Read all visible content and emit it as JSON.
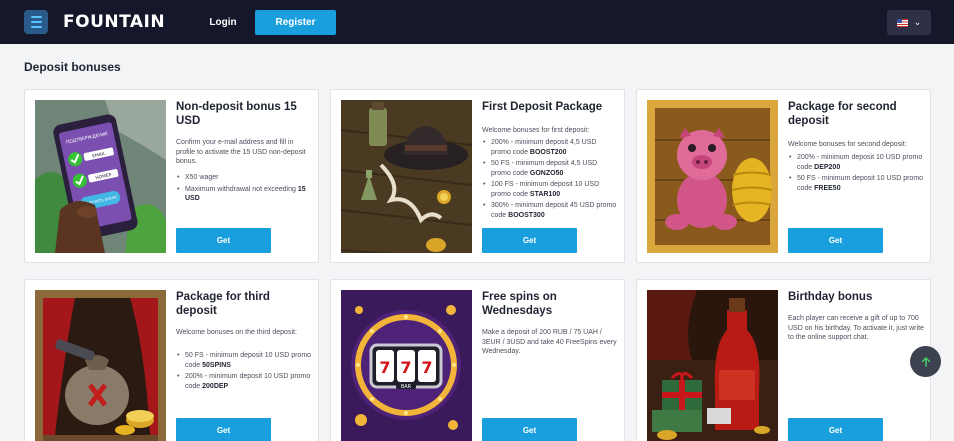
{
  "header": {
    "logo": "FOUNTAIN",
    "login_label": "Login",
    "register_label": "Register",
    "language_flag": "us-flag-icon"
  },
  "section_title": "Deposit bonuses",
  "cards": [
    {
      "title": "Non-deposit bonus 15 USD",
      "description": "Confirm your e-mail address and fill in profile to activate the 15 USD non-deposit bonus.",
      "items": [
        {
          "text": "X50 wager",
          "code": ""
        },
        {
          "text": "Maximum withdrawal not exceeding",
          "code": "15 USD"
        }
      ],
      "button": "Get",
      "image_text": [
        "ПОДТВЕРЖДЕНИЕ",
        "EMAIL",
        "НОМЕР",
        "ПОЛУЧИТЬ БОНУС"
      ]
    },
    {
      "title": "First Deposit Package",
      "description": "Welcome bonuses for first deposit:",
      "items": [
        {
          "text": "200% - minimum deposit 4,5 USD promo code",
          "code": "BOOST200"
        },
        {
          "text": "50 FS - minimum deposit 4,5 USD promo code",
          "code": "GONZO50"
        },
        {
          "text": "100 FS - minimum deposit 10 USD promo code",
          "code": "STAR100"
        },
        {
          "text": "300% - minimum deposit 45 USD promo code",
          "code": "BOOST300"
        }
      ],
      "button": "Get"
    },
    {
      "title": "Package for second deposit",
      "description": "Welcome bonuses for second deposit:",
      "items": [
        {
          "text": "200% - minimum deposit 10 USD promo code",
          "code": "DEP200"
        },
        {
          "text": "50 FS - minimum deposit 10 USD promo code",
          "code": "FREE50"
        }
      ],
      "button": "Get"
    },
    {
      "title": "Package for third deposit",
      "description": "Welcome bonuses on the third deposit:",
      "items": [
        {
          "text": "50 FS - minimum deposit 10 USD promo code",
          "code": "50SPINS"
        },
        {
          "text": "200% - minimum deposit 10 USD promo code",
          "code": "200DEP"
        }
      ],
      "button": "Get"
    },
    {
      "title": "Free spins on Wednesdays",
      "description": "Make a deposit of 200 RUB / 75 UAH / 3EUR / 3USD and take 40 FreeSpins every Wednesday.",
      "items": [],
      "button": "Get",
      "image_text": [
        "7",
        "7",
        "7",
        "BAR"
      ]
    },
    {
      "title": "Birthday bonus",
      "description": "Each player can receive a gift of up to 700 USD on his birthday. To activate it, just write to the online support chat.",
      "items": [],
      "button": "Get"
    }
  ],
  "colors": {
    "accent": "#1a9fde",
    "header_bg": "#15172a",
    "page_bg": "#f3f4f6"
  },
  "icons": {
    "menu": "hamburger-menu-icon",
    "scroll_top": "arrow-up-icon"
  }
}
